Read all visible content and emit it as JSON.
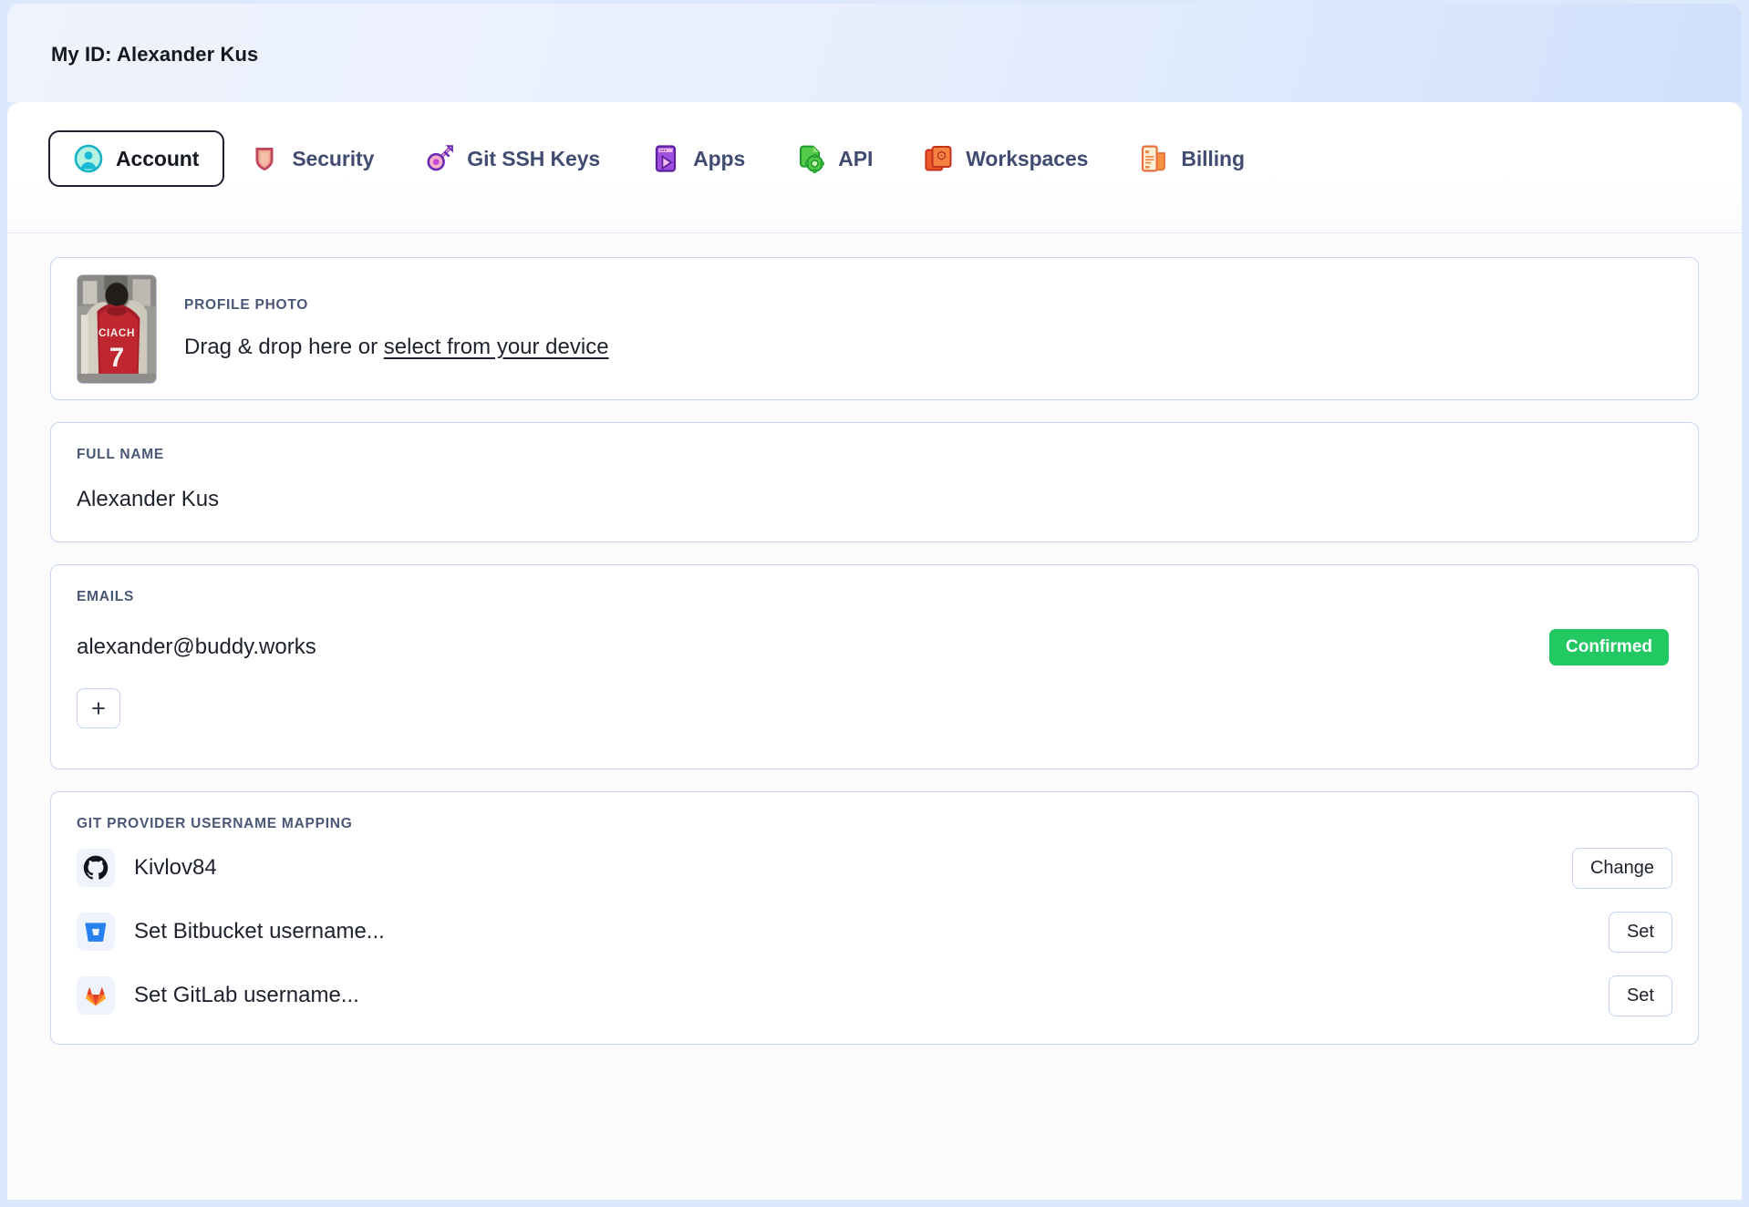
{
  "header": {
    "title": "My ID: Alexander Kus"
  },
  "tabs": [
    {
      "label": "Account",
      "icon": "user-circle-icon",
      "active": true
    },
    {
      "label": "Security",
      "icon": "shield-icon",
      "active": false
    },
    {
      "label": "Git SSH Keys",
      "icon": "key-icon",
      "active": false
    },
    {
      "label": "Apps",
      "icon": "apps-play-icon",
      "active": false
    },
    {
      "label": "API",
      "icon": "api-gear-icon",
      "active": false
    },
    {
      "label": "Workspaces",
      "icon": "workspaces-icon",
      "active": false
    },
    {
      "label": "Billing",
      "icon": "billing-doc-icon",
      "active": false
    }
  ],
  "profile_photo": {
    "label": "PROFILE PHOTO",
    "dropzone_prefix": "Drag & drop here or ",
    "select_link": "select from your device",
    "thumbnail_alt": "CIACH 7 red jersey photo"
  },
  "full_name": {
    "label": "FULL NAME",
    "value": "Alexander Kus"
  },
  "emails": {
    "label": "EMAILS",
    "address": "alexander@buddy.works",
    "status_badge": "Confirmed",
    "add_button": "+"
  },
  "git_mapping": {
    "label": "GIT PROVIDER USERNAME MAPPING",
    "rows": [
      {
        "icon": "github-icon",
        "name": "Kivlov84",
        "action": "Change"
      },
      {
        "icon": "bitbucket-icon",
        "name": "Set Bitbucket username...",
        "action": "Set"
      },
      {
        "icon": "gitlab-icon",
        "name": "Set GitLab username...",
        "action": "Set"
      }
    ]
  },
  "colors": {
    "page_background": "#dce8fc",
    "banner_gradient_start": "#eef3fd",
    "banner_gradient_end": "#cfe0fb",
    "card_border": "#c7d6f1",
    "card_background": "#ffffff",
    "content_background": "#fbfbfc",
    "label_text": "#4a5777",
    "value_text": "#1d222c",
    "tab_inactive_text": "#414d70",
    "tab_active_border": "#1b2130",
    "confirmed_badge": "#22c862",
    "button_border": "#c3d3f0",
    "git_icon_box": "#eef3fd"
  }
}
